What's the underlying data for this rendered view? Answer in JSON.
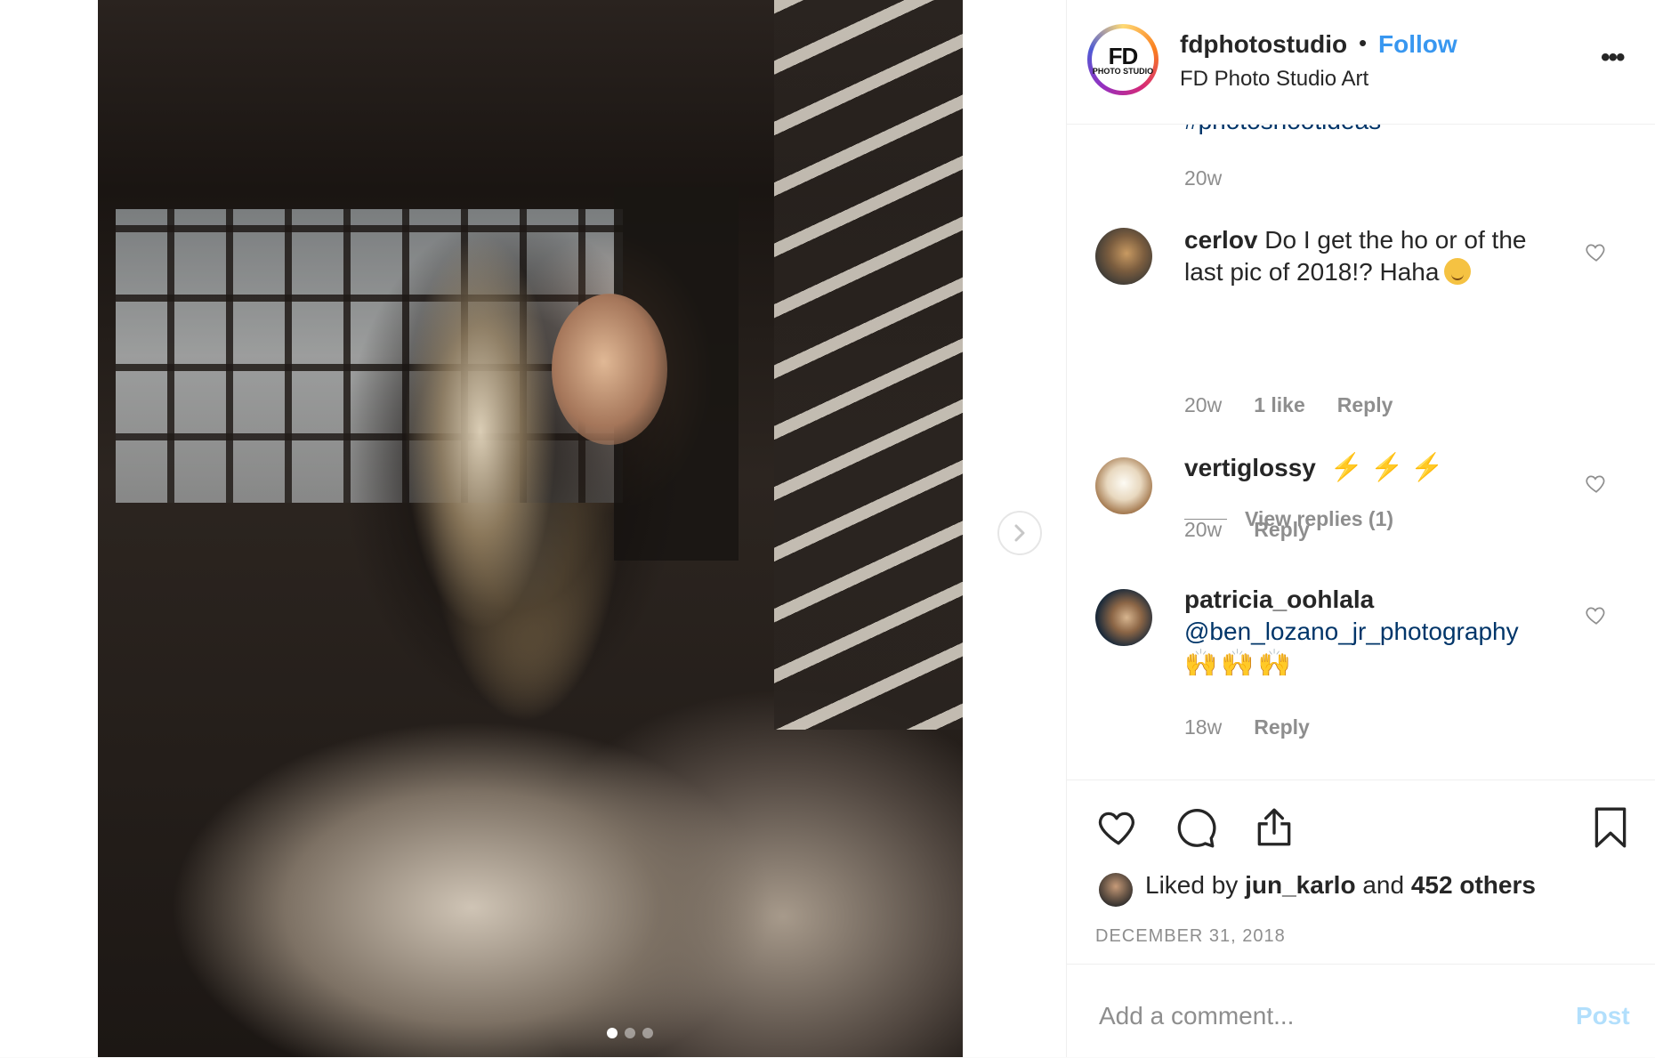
{
  "photo": {
    "carousel": {
      "count": 3,
      "active_index": 0
    },
    "next_icon": "chevron-right-icon"
  },
  "header": {
    "avatar": {
      "logo_text": "FD",
      "logo_sub": "PHOTO STUDIO"
    },
    "username": "fdphotostudio",
    "separator": "•",
    "follow_label": "Follow",
    "subtitle": "FD Photo Studio Art",
    "more_icon": "more-options-icon"
  },
  "comments": {
    "truncated_caption": {
      "hashtag": "#photoshootideas",
      "time": "20w"
    },
    "items": [
      {
        "username": "cerlov",
        "text": "Do I get the ho or of the last pic of 2018!? Haha",
        "emoji": "relieved-face-emoji",
        "time": "20w",
        "likes": "1 like",
        "reply_label": "Reply",
        "view_replies": "View replies (1)"
      },
      {
        "username": "vertiglossy",
        "text": "",
        "emoji": "⚡",
        "time": "20w",
        "reply_label": "Reply"
      },
      {
        "username": "patricia_oohlala",
        "mention": "@ben_lozano_jr_photography",
        "emoji": "🙌🙌🙌",
        "time": "18w",
        "reply_label": "Reply"
      }
    ]
  },
  "actions": {
    "icons": [
      "heart-icon",
      "comment-icon",
      "share-icon",
      "bookmark-icon"
    ],
    "liked_prefix": "Liked by",
    "liked_user": "jun_karlo",
    "liked_and": "and",
    "liked_others": "452 others",
    "date": "DECEMBER 31, 2018"
  },
  "add_comment": {
    "placeholder": "Add a comment...",
    "post_label": "Post"
  },
  "colors": {
    "link_blue": "#3897f0",
    "mention_blue": "#003569",
    "muted": "#8e8e8e",
    "post_disabled": "#b2dffc"
  }
}
